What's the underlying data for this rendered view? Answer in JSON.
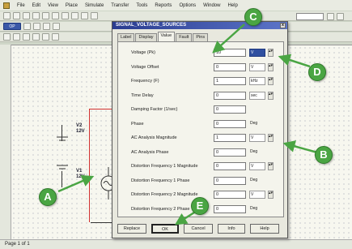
{
  "menubar": {
    "items": [
      "File",
      "Edit",
      "View",
      "Place",
      "Simulate",
      "Transfer",
      "Tools",
      "Reports",
      "Options",
      "Window",
      "Help"
    ]
  },
  "toolbar": {
    "mode_button": "OP"
  },
  "circuit": {
    "source1_label": "V2",
    "source1_value": "12V",
    "source2_label": "V1",
    "source2_value": "12V"
  },
  "dialog": {
    "title": "SIGNAL_VOLTAGE_SOURCES",
    "close_label": "x",
    "tabs": [
      {
        "label": "Label",
        "active": false
      },
      {
        "label": "Display",
        "active": false
      },
      {
        "label": "Value",
        "active": true
      },
      {
        "label": "Fault",
        "active": false
      },
      {
        "label": "Pins",
        "active": false
      }
    ],
    "fields": [
      {
        "label": "Voltage (Pk)",
        "value": "10",
        "unit": "V",
        "unit_selected": true,
        "spinner": true
      },
      {
        "label": "Voltage Offset",
        "value": "0",
        "unit": "V",
        "unit_selected": false,
        "spinner": true
      },
      {
        "label": "Frequency (F)",
        "value": "1",
        "unit": "kHz",
        "unit_selected": false,
        "spinner": true
      },
      {
        "label": "Time Delay",
        "value": "0",
        "unit": "sec",
        "unit_selected": false,
        "spinner": true
      },
      {
        "label": "Damping Factor (1/sec)",
        "value": "0",
        "unit": "",
        "unit_selected": false,
        "spinner": false
      },
      {
        "label": "Phase",
        "value": "0",
        "unit": "Deg",
        "unit_selected": false,
        "spinner": false
      },
      {
        "label": "AC Analysis Magnitude",
        "value": "1",
        "unit": "V",
        "unit_selected": false,
        "spinner": true
      },
      {
        "label": "AC Analysis Phase",
        "value": "0",
        "unit": "Deg",
        "unit_selected": false,
        "spinner": false
      },
      {
        "label": "Distortion Frequency 1 Magnitude",
        "value": "0",
        "unit": "V",
        "unit_selected": false,
        "spinner": true
      },
      {
        "label": "Distortion Frequency 1 Phase",
        "value": "0",
        "unit": "Deg",
        "unit_selected": false,
        "spinner": false
      },
      {
        "label": "Distortion Frequency 2 Magnitude",
        "value": "0",
        "unit": "V",
        "unit_selected": false,
        "spinner": true
      },
      {
        "label": "Distortion Frequency 2 Phase",
        "value": "0",
        "unit": "Deg",
        "unit_selected": false,
        "spinner": false
      }
    ],
    "buttons": {
      "replace": "Replace",
      "ok": "OK",
      "cancel": "Cancel",
      "info": "Info",
      "help": "Help"
    }
  },
  "callouts": {
    "a": "A",
    "b": "B",
    "c": "C",
    "d": "D",
    "e": "E"
  },
  "status": {
    "text": "Page 1 of 1"
  },
  "colors": {
    "callout": "#4aa543",
    "title_bar": "#2a3c90"
  }
}
